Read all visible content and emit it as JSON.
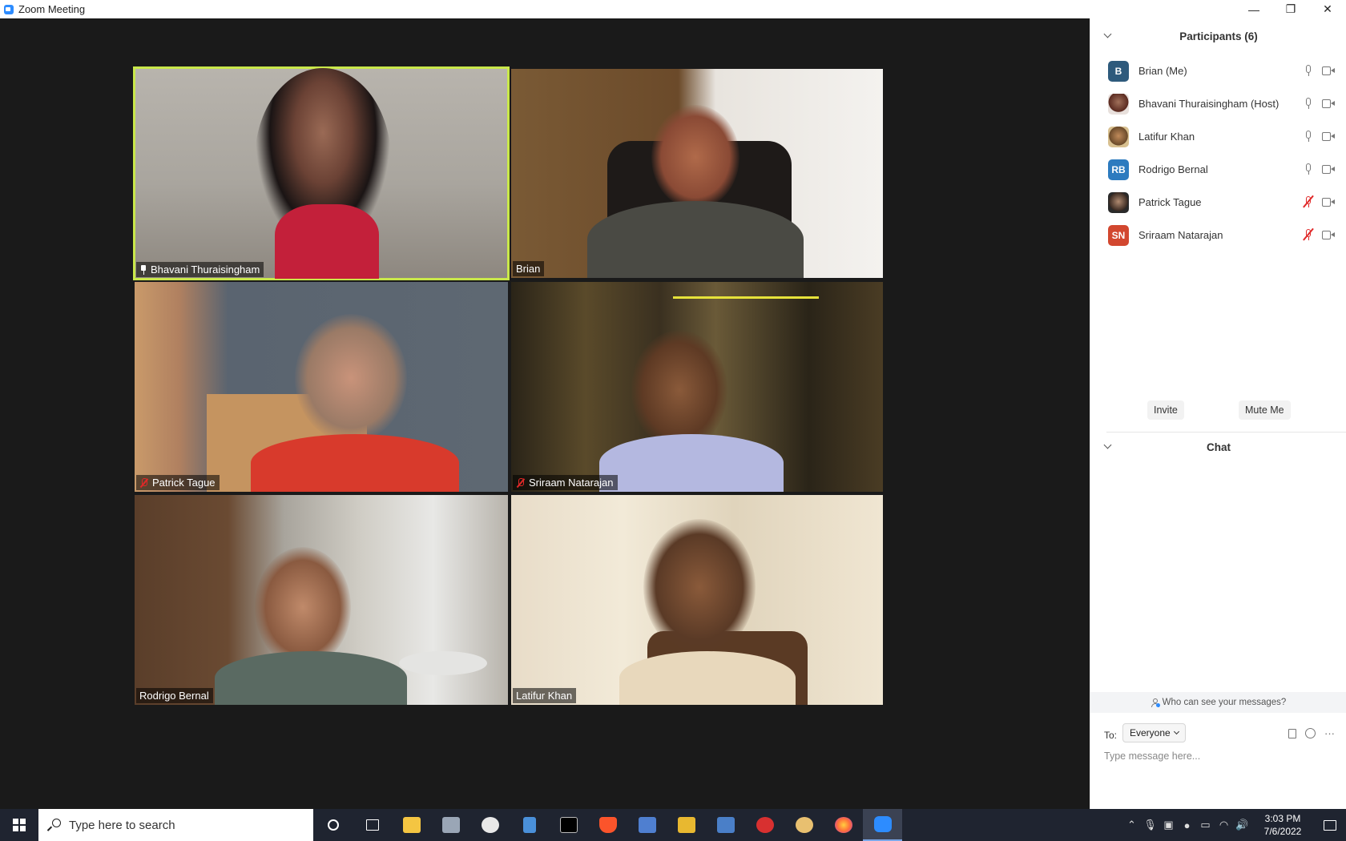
{
  "window": {
    "title": "Zoom Meeting"
  },
  "window_controls": {
    "minimize": "—",
    "restore": "❐",
    "close": "✕"
  },
  "tiles": [
    {
      "name": "Bhavani Thuraisingham",
      "pinned": true,
      "muted": false
    },
    {
      "name": "Brian",
      "pinned": false,
      "muted": false
    },
    {
      "name": "Patrick Tague",
      "pinned": false,
      "muted": true
    },
    {
      "name": "Sriraam Natarajan",
      "pinned": false,
      "muted": true
    },
    {
      "name": "Rodrigo Bernal",
      "pinned": false,
      "muted": false
    },
    {
      "name": "Latifur Khan",
      "pinned": false,
      "muted": false
    }
  ],
  "participants_panel": {
    "title": "Participants (6)",
    "items": [
      {
        "initials": "B",
        "name": "Brian (Me)",
        "avatar_color": "#2e5a7c",
        "muted": false
      },
      {
        "initials": "",
        "name": "Bhavani Thuraisingham (Host)",
        "avatar_color": "#7b3a2a",
        "muted": false
      },
      {
        "initials": "",
        "name": "Latifur Khan",
        "avatar_color": "#8a6a3a",
        "muted": false
      },
      {
        "initials": "RB",
        "name": "Rodrigo Bernal",
        "avatar_color": "#2d7bbf",
        "muted": false
      },
      {
        "initials": "",
        "name": "Patrick Tague",
        "avatar_color": "#3a3a3a",
        "muted": true
      },
      {
        "initials": "SN",
        "name": "Sriraam Natarajan",
        "avatar_color": "#d2472f",
        "muted": true
      }
    ],
    "invite_label": "Invite",
    "mute_me_label": "Mute Me"
  },
  "chat_panel": {
    "title": "Chat",
    "who_can_see": "Who can see your messages?",
    "to_label": "To:",
    "to_value": "Everyone",
    "message_placeholder": "Type message here..."
  },
  "taskbar": {
    "search_placeholder": "Type here to search",
    "time": "3:03 PM",
    "date": "7/6/2022"
  }
}
